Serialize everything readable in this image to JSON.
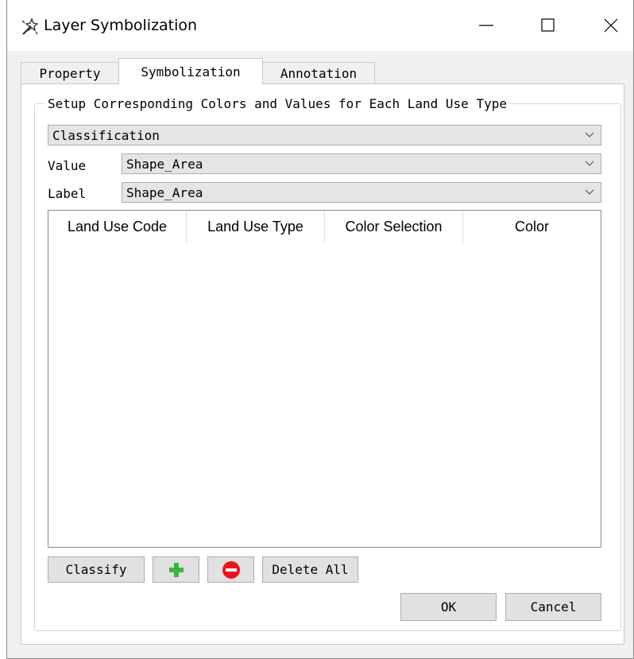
{
  "window": {
    "title": "Layer Symbolization",
    "icon": "magic-wand-icon",
    "controls": [
      "minimize-icon",
      "maximize-icon",
      "close-icon"
    ]
  },
  "tabs": [
    {
      "label": "Property",
      "active": false
    },
    {
      "label": "Symbolization",
      "active": true
    },
    {
      "label": "Annotation",
      "active": false
    }
  ],
  "group": {
    "title": "Setup Corresponding Colors and Values for Each Land Use Type"
  },
  "classification_combo": {
    "value": "Classification"
  },
  "value_field": {
    "label": "Value",
    "value": "Shape_Area"
  },
  "label_field": {
    "label": "Label",
    "value": "Shape_Area"
  },
  "table": {
    "columns": [
      "Land Use Code",
      "Land Use Type",
      "Color Selection",
      "Color"
    ],
    "rows": []
  },
  "buttons": {
    "classify": "Classify",
    "add_icon": "plus-icon",
    "remove_icon": "minus-icon",
    "delete_all": "Delete All",
    "ok": "OK",
    "cancel": "Cancel"
  },
  "colors": {
    "add_green": "#3cb43c",
    "remove_red": "#e8141e"
  }
}
